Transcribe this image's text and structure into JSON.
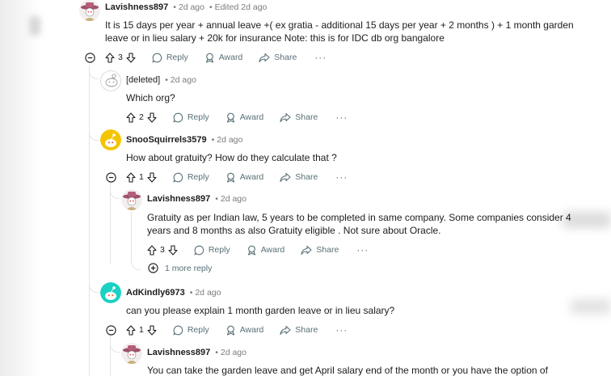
{
  "comments": [
    {
      "username": "Lavishness897",
      "time": "2d ago",
      "edited": "Edited 2d ago",
      "body_line1": "It is 15 days per year + annual leave +( ex gratia - additional 15 days per year + 2 months ) + 1 month garden",
      "body_line2": "leave or in lieu salary + 20k for insurance Note: this is for IDC db org bangalore",
      "votes": "3",
      "avatar": "cowboy-avatar"
    },
    {
      "username": "[deleted]",
      "time": "2d ago",
      "body_line1": "Which org?",
      "votes": "2",
      "avatar": "deleted-avatar"
    },
    {
      "username": "SnooSquirrels3579",
      "time": "2d ago",
      "body_line1": "How about gratuity? How do they calculate that ?",
      "votes": "1",
      "avatar": "yellow-snoo-avatar"
    },
    {
      "username": "Lavishness897",
      "time": "2d ago",
      "body_line1": "Gratuity as per Indian law, 5 years to be completed in same company. Some companies consider 4",
      "body_line2": "years and 8 months as also Gratuity eligible . Not sure about Oracle.",
      "votes": "3",
      "avatar": "cowboy-avatar"
    },
    {
      "username": "AdKindly6973",
      "time": "2d ago",
      "body_line1": "can you please explain 1 month garden leave or in lieu salary?",
      "votes": "1",
      "avatar": "teal-snoo-avatar"
    },
    {
      "username": "Lavishness897",
      "time": "2d ago",
      "body_line1": "You can take the garden leave and get April salary end of the month or you have the option of",
      "avatar": "cowboy-avatar"
    }
  ],
  "actions": {
    "reply": "Reply",
    "award": "Award",
    "share": "Share",
    "more": "···"
  },
  "more_replies": "1 more reply",
  "colors": {
    "meta": "#7c7c7c",
    "action": "#576f76",
    "thread": "#e4e4e4",
    "yellow_avatar": "#f5c400",
    "teal_avatar": "#1ad1c2"
  }
}
